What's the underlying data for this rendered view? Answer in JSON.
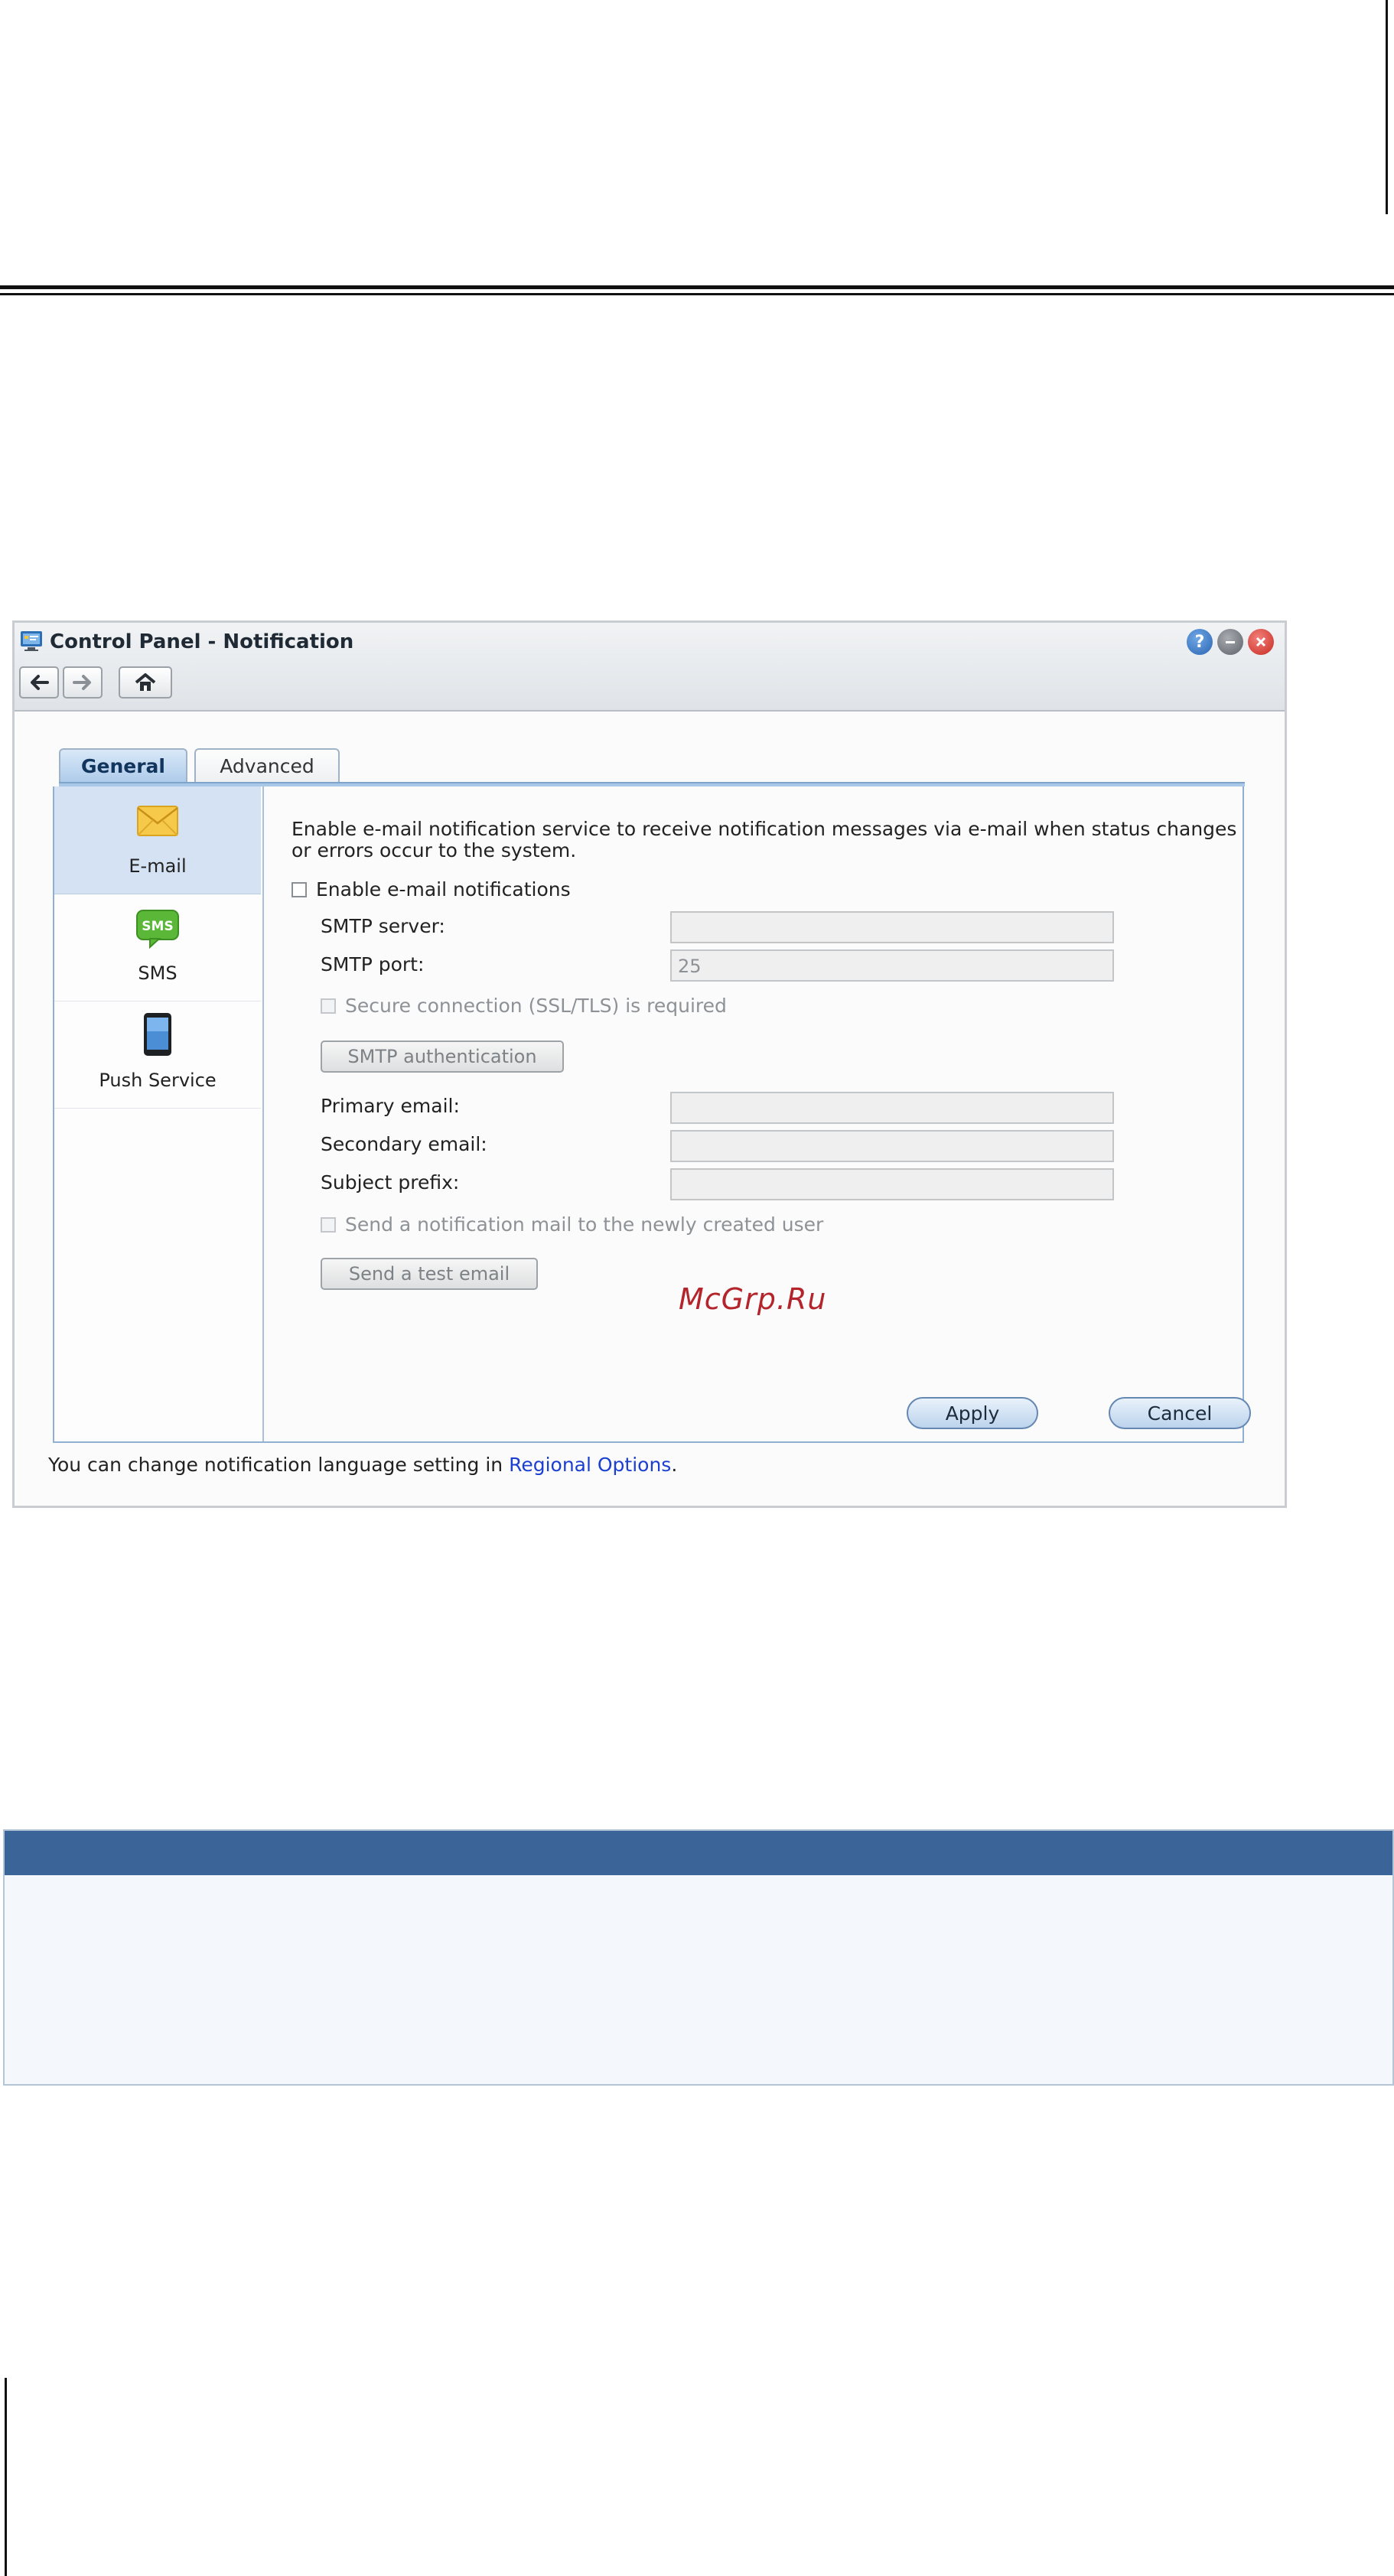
{
  "window": {
    "title": "Control Panel - Notification",
    "title_buttons": [
      "help-icon",
      "minimize-icon",
      "close-icon"
    ],
    "nav": [
      "back-arrow-icon",
      "forward-arrow-icon",
      "home-icon"
    ]
  },
  "tabs": [
    {
      "label": "General",
      "active": true
    },
    {
      "label": "Advanced",
      "active": false
    }
  ],
  "sidebar": {
    "items": [
      {
        "label": "E-mail",
        "icon": "envelope-icon",
        "selected": true
      },
      {
        "label": "SMS",
        "icon": "sms-icon",
        "selected": false
      },
      {
        "label": "Push Service",
        "icon": "mobile-device-icon",
        "selected": false
      }
    ]
  },
  "email": {
    "description": "Enable e-mail notification service to receive notification messages via e-mail when status changes or errors occur to the system.",
    "enable_label": "Enable e-mail notifications",
    "smtp_server_label": "SMTP server:",
    "smtp_server_value": "",
    "smtp_port_label": "SMTP port:",
    "smtp_port_value": "25",
    "secure_label": "Secure connection (SSL/TLS) is required",
    "smtp_auth_button": "SMTP authentication",
    "primary_email_label": "Primary email:",
    "secondary_email_label": "Secondary email:",
    "subject_prefix_label": "Subject prefix:",
    "notify_new_user_label": "Send a notification mail to the newly created user",
    "test_email_button": "Send a test email",
    "apply_button": "Apply",
    "cancel_button": "Cancel"
  },
  "watermark": "McGrp.Ru",
  "footer": {
    "note_prefix": "You can change notification language setting in ",
    "note_link": "Regional Options",
    "note_suffix": "."
  },
  "colors": {
    "accent": "#3b6598",
    "link": "#1a3fd1",
    "watermark": "#b3242b"
  }
}
